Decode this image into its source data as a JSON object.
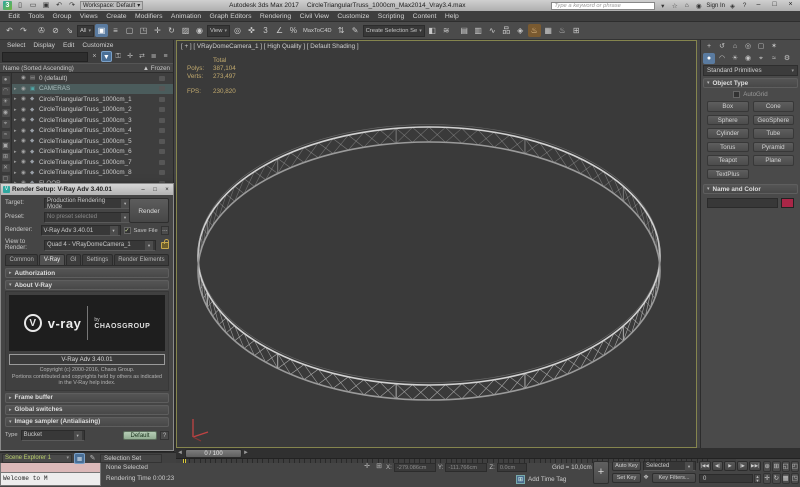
{
  "icons": {
    "dd": "▾",
    "up": "▲",
    "check": "✓",
    "dots": "…",
    "q": "?",
    "plus": "+",
    "min": "–",
    "max": "□",
    "close": "×",
    "collapsed": "▸",
    "expanded": "▾",
    "slider_l": "◄",
    "slider_r": "►"
  },
  "app": {
    "workspace_label": "Workspace: Default",
    "title": "Autodesk 3ds Max 2017",
    "document": "CircleTriangularTruss_1000cm_Max2014_Vray3.4.max",
    "search_placeholder": "Type a keyword or phrase",
    "sign_in": "Sign In"
  },
  "menus": [
    "Edit",
    "Tools",
    "Group",
    "Views",
    "Create",
    "Modifiers",
    "Animation",
    "Graph Editors",
    "Rendering",
    "Civil View",
    "Customize",
    "Scripting",
    "Content",
    "Help"
  ],
  "toolbar": {
    "items": [
      {
        "k": "icon",
        "n": "undo-icon",
        "g": "↶"
      },
      {
        "k": "icon",
        "n": "redo-icon",
        "g": "↷"
      },
      {
        "k": "sep",
        "n": "separator"
      },
      {
        "k": "icon",
        "n": "select-link-icon",
        "g": "✇"
      },
      {
        "k": "icon",
        "n": "unlink-icon",
        "g": "⊘"
      },
      {
        "k": "icon",
        "n": "bind-spacewarp-icon",
        "g": "⇘"
      },
      {
        "k": "dd",
        "n": "selection-filter-dropdown",
        "t": "All"
      },
      {
        "k": "icon",
        "n": "select-object-icon",
        "g": "▣",
        "hl": "blue"
      },
      {
        "k": "icon",
        "n": "select-by-name-icon",
        "g": "≡"
      },
      {
        "k": "icon",
        "n": "rect-selection-region-icon",
        "g": "▢"
      },
      {
        "k": "icon",
        "n": "window-crossing-icon",
        "g": "◳"
      },
      {
        "k": "icon",
        "n": "select-move-icon",
        "g": "✛"
      },
      {
        "k": "icon",
        "n": "select-rotate-icon",
        "g": "↻"
      },
      {
        "k": "icon",
        "n": "select-scale-icon",
        "g": "▨"
      },
      {
        "k": "icon",
        "n": "select-place-icon",
        "g": "◉"
      },
      {
        "k": "dd",
        "n": "ref-coordsys-dropdown",
        "t": "View"
      },
      {
        "k": "icon",
        "n": "use-pivot-center-icon",
        "g": "◎"
      },
      {
        "k": "icon",
        "n": "select-manipulate-icon",
        "g": "✜"
      },
      {
        "k": "icon",
        "n": "snap-toggle-icon",
        "g": "3"
      },
      {
        "k": "icon",
        "n": "angle-snap-icon",
        "g": "∠"
      },
      {
        "k": "icon",
        "n": "percent-snap-icon",
        "g": "%"
      },
      {
        "k": "label",
        "n": "maxtoc4d-label",
        "t": "MaxToC4D"
      },
      {
        "k": "icon",
        "n": "spinner-snap-icon",
        "g": "⇅"
      },
      {
        "k": "icon",
        "n": "edit-named-selections-icon",
        "g": "✎"
      },
      {
        "k": "dd",
        "n": "named-selection-dropdown",
        "t": "Create Selection Se"
      },
      {
        "k": "icon",
        "n": "mirror-icon",
        "g": "◧"
      },
      {
        "k": "icon",
        "n": "align-icon",
        "g": "≋"
      },
      {
        "k": "sep",
        "n": "separator"
      },
      {
        "k": "icon",
        "n": "layer-manager-icon",
        "g": "▤"
      },
      {
        "k": "icon",
        "n": "ribbon-toggle-icon",
        "g": "▥"
      },
      {
        "k": "icon",
        "n": "curve-editor-icon",
        "g": "∿"
      },
      {
        "k": "icon",
        "n": "schematic-view-icon",
        "g": "品"
      },
      {
        "k": "icon",
        "n": "material-editor-icon",
        "g": "◈"
      },
      {
        "k": "icon",
        "n": "render-setup-icon",
        "g": "♨",
        "hl": "orange"
      },
      {
        "k": "icon",
        "n": "rendered-frame-icon",
        "g": "▦"
      },
      {
        "k": "icon",
        "n": "render-production-icon",
        "g": "♨"
      },
      {
        "k": "icon",
        "n": "render-iterative-icon",
        "g": "⊞"
      }
    ]
  },
  "scene_explorer": {
    "menu": [
      "Select",
      "Display",
      "Edit",
      "Customize"
    ],
    "search_placeholder": "",
    "search_icons": [
      {
        "n": "clear-search-icon",
        "g": "×"
      },
      {
        "n": "filter-icon",
        "g": "▼",
        "hl": true
      },
      {
        "n": "lock-explorer-icon",
        "g": "⚿"
      },
      {
        "n": "pick-parent-icon",
        "g": "✛"
      },
      {
        "n": "sync-selection-icon",
        "g": "⇄"
      },
      {
        "n": "hierarchy-mode-icon",
        "g": "≣"
      },
      {
        "n": "layer-mode-icon",
        "g": "≡"
      }
    ],
    "side_icons": [
      {
        "n": "display-geometry-icon",
        "g": "●"
      },
      {
        "n": "display-shapes-icon",
        "g": "◠"
      },
      {
        "n": "display-lights-icon",
        "g": "☀"
      },
      {
        "n": "display-cameras-icon",
        "g": "◉"
      },
      {
        "n": "display-helpers-icon",
        "g": "⌖"
      },
      {
        "n": "display-spacewarps-icon",
        "g": "≈"
      },
      {
        "n": "display-groups-icon",
        "g": "▣"
      },
      {
        "n": "display-xrefs-icon",
        "g": "⊞"
      },
      {
        "n": "display-bones-icon",
        "g": "✕"
      },
      {
        "n": "display-containers-icon",
        "g": "▢"
      }
    ],
    "header": {
      "name": "Name (Sorted Ascending)",
      "sort_arrow": "▲",
      "frozen": "Frozen"
    },
    "rows": [
      {
        "label": "0 (default)",
        "icon": "layer-icon",
        "glyph": "▤",
        "arrow": false,
        "color": "#9a9a9a"
      },
      {
        "label": "CAMERAS",
        "icon": "camera-group-icon",
        "glyph": "▣",
        "arrow": true,
        "selected": true,
        "color": "#4fa8a8"
      },
      {
        "label": "CircleTriangularTruss_1000cm_1",
        "icon": "geometry-icon",
        "glyph": "◆",
        "arrow": true,
        "color": "#9aa0a8"
      },
      {
        "label": "CircleTriangularTruss_1000cm_2",
        "icon": "geometry-icon",
        "glyph": "◆",
        "arrow": true,
        "color": "#9aa0a8"
      },
      {
        "label": "CircleTriangularTruss_1000cm_3",
        "icon": "geometry-icon",
        "glyph": "◆",
        "arrow": true,
        "color": "#9aa0a8"
      },
      {
        "label": "CircleTriangularTruss_1000cm_4",
        "icon": "geometry-icon",
        "glyph": "◆",
        "arrow": true,
        "color": "#9aa0a8"
      },
      {
        "label": "CircleTriangularTruss_1000cm_5",
        "icon": "geometry-icon",
        "glyph": "◆",
        "arrow": true,
        "color": "#9aa0a8"
      },
      {
        "label": "CircleTriangularTruss_1000cm_6",
        "icon": "geometry-icon",
        "glyph": "◆",
        "arrow": true,
        "color": "#9aa0a8"
      },
      {
        "label": "CircleTriangularTruss_1000cm_7",
        "icon": "geometry-icon",
        "glyph": "◆",
        "arrow": true,
        "color": "#9aa0a8"
      },
      {
        "label": "CircleTriangularTruss_1000cm_8",
        "icon": "geometry-icon",
        "glyph": "◆",
        "arrow": true,
        "color": "#9aa0a8"
      },
      {
        "label": "FLOOR",
        "icon": "geometry-icon",
        "glyph": "◆",
        "arrow": true,
        "color": "#9aa0a8"
      }
    ],
    "footer": {
      "explorer_name": "Scene Explorer 1",
      "selection_set": "Selection Set"
    }
  },
  "vray_dialog": {
    "title": "Render Setup: V-Ray Adv 3.40.01",
    "target_label": "Target:",
    "target_value": "Production Rendering Mode",
    "preset_label": "Preset:",
    "preset_value": "No preset selected",
    "renderer_label": "Renderer:",
    "renderer_value": "V-Ray Adv 3.40.01",
    "save_file_label": "Save File",
    "view_label": "View to Render:",
    "view_value": "Quad 4 - VRayDomeCamera_1",
    "render_button": "Render",
    "tabs": [
      "Common",
      "V-Ray",
      "GI",
      "Settings",
      "Render Elements"
    ],
    "active_tab": "V-Ray",
    "rollout_authorization": "Authorization",
    "rollout_about": "About V-Ray",
    "logo_brand": "v-ray",
    "logo_v": "V",
    "logo_by": "by",
    "logo_company": "CHAOSGROUP",
    "version_box": "V-Ray Adv 3.40.01",
    "copyright_1": "Copyright (c) 2000-2016, Chaos Group.",
    "copyright_2": "Portions contributed and copyrights held by others as indicated",
    "copyright_3": "in the V-Ray help index.",
    "rollout_framebuffer": "Frame buffer",
    "rollout_globalswitches": "Global switches",
    "rollout_imagesampler": "Image sampler (Antialiasing)",
    "type_label": "Type",
    "type_value": "Bucket",
    "default_button": "Default"
  },
  "viewport": {
    "label": "[ + ] [ VRayDomeCamera_1 ] [ High Quality ] [ Default Shading ]",
    "stats": {
      "total_header": "Total",
      "polys_label": "Polys:",
      "polys": "387,104",
      "verts_label": "Verts:",
      "verts": "273,497",
      "fps_label": "FPS:",
      "fps": "230,820"
    }
  },
  "command_panel": {
    "panel_icons": [
      {
        "n": "create-tab-icon",
        "g": "+",
        "active": false
      },
      {
        "n": "modify-tab-icon",
        "g": "↺"
      },
      {
        "n": "hierarchy-tab-icon",
        "g": "⌂"
      },
      {
        "n": "motion-tab-icon",
        "g": "◎"
      },
      {
        "n": "display-tab-icon",
        "g": "▢"
      },
      {
        "n": "utilities-tab-icon",
        "g": "✶"
      }
    ],
    "category_icons": [
      {
        "n": "geometry-category-icon",
        "g": "●",
        "active": true
      },
      {
        "n": "shapes-category-icon",
        "g": "◠"
      },
      {
        "n": "lights-category-icon",
        "g": "☀"
      },
      {
        "n": "cameras-category-icon",
        "g": "◉"
      },
      {
        "n": "helpers-category-icon",
        "g": "⌖"
      },
      {
        "n": "spacewarps-category-icon",
        "g": "≈"
      },
      {
        "n": "systems-category-icon",
        "g": "⚙"
      }
    ],
    "category": "Standard Primitives",
    "object_type": "Object Type",
    "autogrid": "AutoGrid",
    "buttons": [
      "Box",
      "Cone",
      "Sphere",
      "GeoSphere",
      "Cylinder",
      "Tube",
      "Torus",
      "Pyramid",
      "Teapot",
      "Plane",
      "TextPlus"
    ],
    "name_color": "Name and Color"
  },
  "timeline": {
    "slider": "0 / 100",
    "start": 0,
    "end": 100,
    "label_step": 5,
    "current": 0
  },
  "status": {
    "listener_text": "Welcome to M",
    "none_selected": "None Selected",
    "rendering_time": "Rendering Time  0:00:23",
    "lock_icon": "✛",
    "abs_icon": "⊞",
    "x_label": "X:",
    "x_value": "-279.086cm",
    "y_label": "Y:",
    "y_value": "-111.766cm",
    "z_label": "Z:",
    "z_value": "0.0cm",
    "grid_label": "Grid = 10,0cm",
    "add_time_tag": "Add Time Tag"
  },
  "anim": {
    "set_keys": "+",
    "auto_key": "Auto Key",
    "set_key": "Set Key",
    "selected": "Selected",
    "key_filters": "Key Filters...",
    "paw": "❖",
    "frame": "0",
    "transport": [
      {
        "n": "go-to-start-button",
        "g": "|◀◀"
      },
      {
        "n": "prev-frame-button",
        "g": "◀|"
      },
      {
        "n": "play-button",
        "g": "▶"
      },
      {
        "n": "next-frame-button",
        "g": "|▶"
      },
      {
        "n": "go-to-end-button",
        "g": "▶▶|"
      }
    ],
    "nav": [
      {
        "n": "zoom-icon",
        "g": "⊕"
      },
      {
        "n": "zoom-all-icon",
        "g": "⊞"
      },
      {
        "n": "zoom-extents-icon",
        "g": "◱"
      },
      {
        "n": "zoom-region-icon",
        "g": "◰"
      },
      {
        "n": "pan-icon",
        "g": "✛"
      },
      {
        "n": "orbit-icon",
        "g": "↻"
      },
      {
        "n": "zoom-extents-all-icon",
        "g": "▦"
      },
      {
        "n": "maximize-viewport-icon",
        "g": "◳"
      }
    ]
  }
}
